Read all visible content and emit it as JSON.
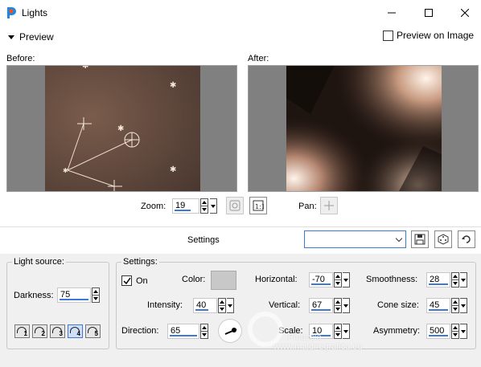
{
  "window": {
    "title": "Lights"
  },
  "preview": {
    "label": "Preview",
    "preview_on_image": "Preview on Image"
  },
  "panes": {
    "before_label": "Before:",
    "after_label": "After:"
  },
  "zoom": {
    "label": "Zoom:",
    "value": "19",
    "pan_label": "Pan:"
  },
  "settings_bar": {
    "title": "Settings",
    "preset_value": ""
  },
  "light_source": {
    "title": "Light source:",
    "darkness_label": "Darkness:",
    "darkness_value": "75",
    "buttons": [
      "1",
      "2",
      "3",
      "4",
      "5"
    ],
    "selected": "4"
  },
  "settings": {
    "title": "Settings:",
    "on_label": "On",
    "on_checked": true,
    "color_label": "Color:",
    "color_value": "#c8c8c8",
    "intensity_label": "Intensity:",
    "intensity_value": "40",
    "direction_label": "Direction:",
    "direction_value": "65",
    "horizontal_label": "Horizontal:",
    "horizontal_value": "-70",
    "vertical_label": "Vertical:",
    "vertical_value": "67",
    "scale_label": "Scale:",
    "scale_value": "10",
    "smoothness_label": "Smoothness:",
    "smoothness_value": "28",
    "cone_size_label": "Cone size:",
    "cone_size_value": "45",
    "asymmetry_label": "Asymmetry:",
    "asymmetry_value": "500"
  },
  "watermark": {
    "line1": "Pinuccia",
    "line2": "www.maldiregrafica.eu"
  },
  "colors": {
    "accent": "#3c78d8",
    "preview_bg": "#808080",
    "image_brown": "#6e5446"
  }
}
